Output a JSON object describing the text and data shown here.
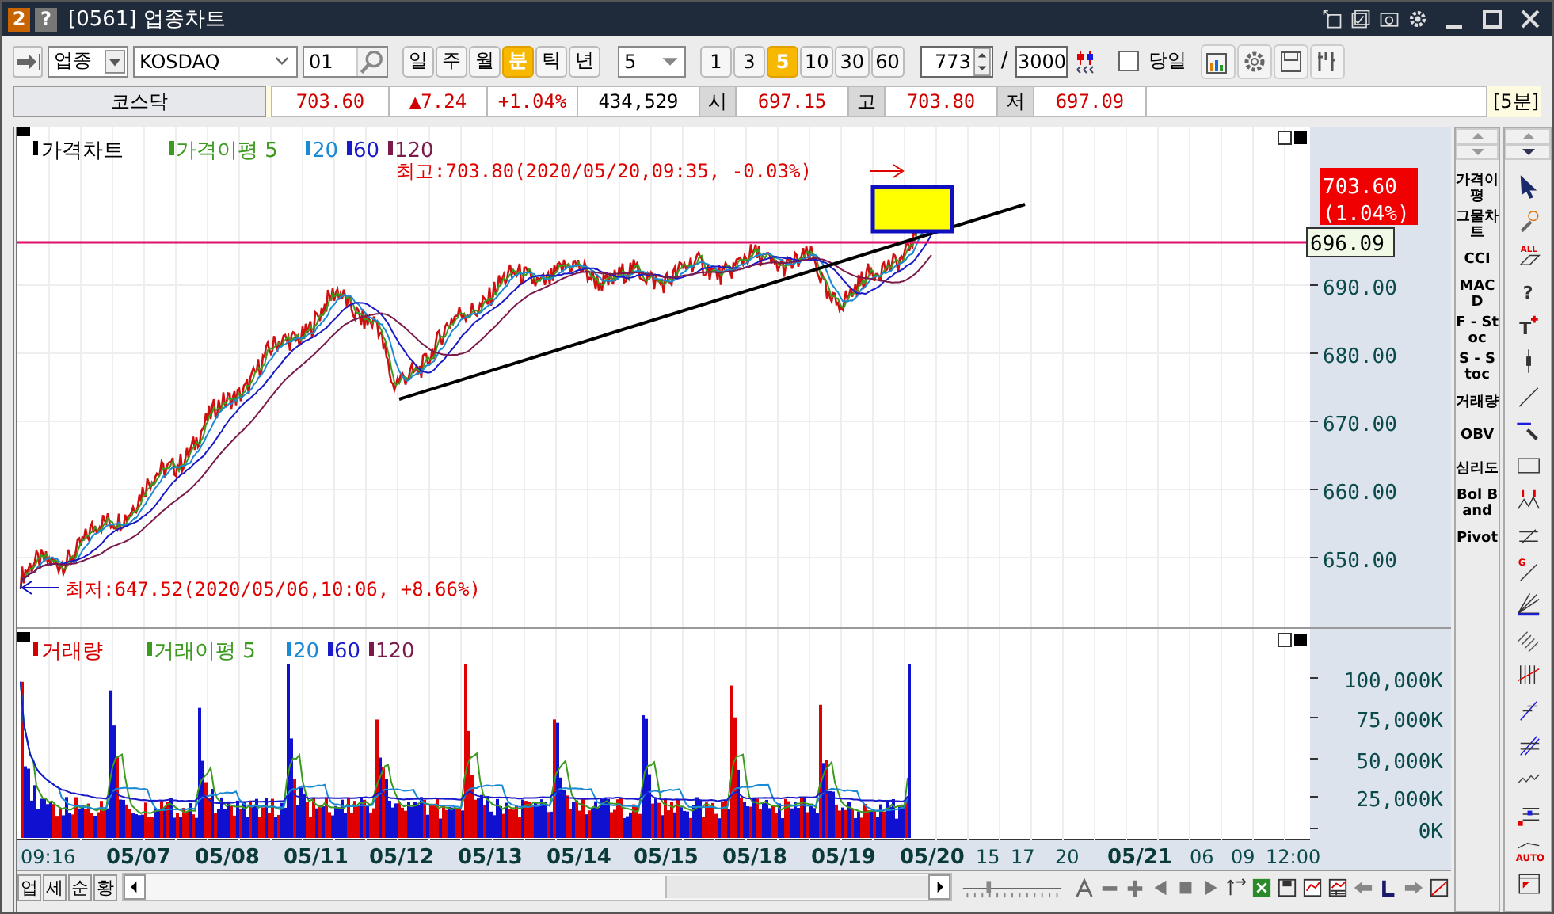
{
  "window": {
    "badge": "2",
    "help": "?",
    "title": "[0561] 업종차트"
  },
  "toolbar": {
    "market_type": "업종",
    "code_name": "KOSDAQ",
    "code": "01",
    "periods": [
      {
        "label": "일",
        "selected": false
      },
      {
        "label": "주",
        "selected": false
      },
      {
        "label": "월",
        "selected": false
      },
      {
        "label": "분",
        "selected": true
      },
      {
        "label": "틱",
        "selected": false
      },
      {
        "label": "년",
        "selected": false
      }
    ],
    "interval": "5",
    "intervals": [
      {
        "label": "1",
        "selected": false
      },
      {
        "label": "3",
        "selected": false
      },
      {
        "label": "5",
        "selected": true
      },
      {
        "label": "10",
        "selected": false
      },
      {
        "label": "30",
        "selected": false
      },
      {
        "label": "60",
        "selected": false
      }
    ],
    "count": "773",
    "separator": "/",
    "total": "3000",
    "same_day": {
      "label": "당일",
      "checked": false
    }
  },
  "quote": {
    "name": "코스닥",
    "price": "703.60",
    "change": "▲7.24",
    "rate": "+1.04%",
    "volume": "434,529",
    "fields": [
      {
        "label": "시",
        "value": "697.15"
      },
      {
        "label": "고",
        "value": "703.80"
      },
      {
        "label": "저",
        "value": "697.09"
      }
    ],
    "unit": "[5분]"
  },
  "price_pane": {
    "legend": [
      {
        "label": "가격차트",
        "color": "#000000"
      },
      {
        "label": "가격이평 5",
        "color": "#3c9a1e"
      },
      {
        "label": "20",
        "color": "#1a8ad4"
      },
      {
        "label": "60",
        "color": "#1a1ac8"
      },
      {
        "label": "120",
        "color": "#7a1a4a"
      }
    ],
    "high_note": "최고:703.80(2020/05/20,09:35, -0.03%)",
    "low_note": "최저:647.52(2020/05/06,10:06, +8.66%)",
    "current_price": "703.60",
    "current_rate": "(1.04%)",
    "line_value": "696.09",
    "y_labels": [
      "690.00",
      "680.00",
      "670.00",
      "660.00",
      "650.00"
    ]
  },
  "volume_pane": {
    "legend": [
      {
        "label": "거래량",
        "color": "#d40000"
      },
      {
        "label": "거래이평 5",
        "color": "#3c9a1e"
      },
      {
        "label": "20",
        "color": "#1a8ad4"
      },
      {
        "label": "60",
        "color": "#1a1ac8"
      },
      {
        "label": "120",
        "color": "#7a1a4a"
      }
    ],
    "y_labels": [
      "100,000K",
      "75,000K",
      "50,000K",
      "25,000K",
      "0K"
    ]
  },
  "x_axis": [
    {
      "label": "09:16",
      "kind": "time"
    },
    {
      "label": "05/07",
      "kind": "date"
    },
    {
      "label": "05/08",
      "kind": "date"
    },
    {
      "label": "05/11",
      "kind": "date"
    },
    {
      "label": "05/12",
      "kind": "date"
    },
    {
      "label": "05/13",
      "kind": "date"
    },
    {
      "label": "05/14",
      "kind": "date"
    },
    {
      "label": "05/15",
      "kind": "date"
    },
    {
      "label": "05/18",
      "kind": "date"
    },
    {
      "label": "05/19",
      "kind": "date"
    },
    {
      "label": "05/20",
      "kind": "date"
    },
    {
      "label": "15",
      "kind": "time"
    },
    {
      "label": "17",
      "kind": "time"
    },
    {
      "label": "20",
      "kind": "time"
    },
    {
      "label": "05/21",
      "kind": "date"
    },
    {
      "label": "06",
      "kind": "time"
    },
    {
      "label": "09",
      "kind": "time"
    },
    {
      "label": "12:00",
      "kind": "time"
    }
  ],
  "indicators": [
    "가격이평",
    "그물차트",
    "CCI",
    "MACD",
    "F - Stoc",
    "S - Stoc",
    "거래량",
    "OBV",
    "심리도",
    "Bol Band",
    "Pivot"
  ],
  "bottom_tabs": [
    "업",
    "세",
    "순",
    "황"
  ],
  "zoom_slider": {
    "level": 0.25
  },
  "tool_marks": [
    "ALL",
    "?",
    "T",
    "G",
    "AUTO"
  ]
}
